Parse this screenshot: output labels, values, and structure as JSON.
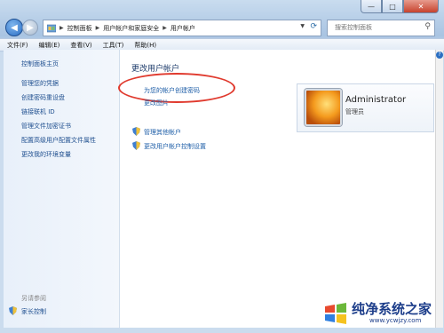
{
  "window": {
    "controls": [
      "—",
      "□",
      "✕"
    ]
  },
  "address": {
    "segments": [
      "控制面板",
      "用户帐户和家庭安全",
      "用户帐户"
    ],
    "search_placeholder": "搜索控制面板"
  },
  "menu": [
    "文件(F)",
    "编辑(E)",
    "查看(V)",
    "工具(T)",
    "帮助(H)"
  ],
  "sidebar": {
    "home": "控制面板主页",
    "items": [
      "管理您的凭据",
      "创建密码重设盘",
      "链接联机 ID",
      "管理文件加密证书",
      "配置高级用户配置文件属性",
      "更改我的环境变量"
    ],
    "see_also": "另请参阅",
    "parental": "家长控制"
  },
  "main": {
    "title": "更改用户帐户",
    "create_password": "为您的帐户创建密码",
    "change_picture": "更改图片",
    "manage_other": "管理其他帐户",
    "uac_settings": "更改用户帐户控制设置"
  },
  "account": {
    "name": "Administrator",
    "role": "管理员"
  },
  "watermark": {
    "text": "纯净系统之家",
    "url": "www.ycwjzy.com"
  },
  "colors": {
    "highlight": "#e03a2e",
    "link": "#1f5fa8"
  }
}
